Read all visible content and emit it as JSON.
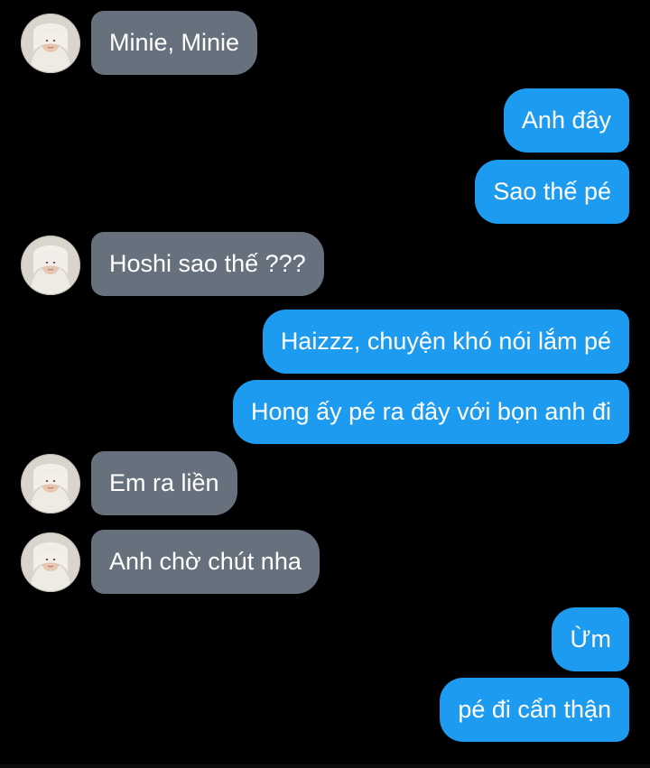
{
  "colors": {
    "background": "#000000",
    "incoming_bubble": "#67717d",
    "outgoing_bubble": "#1d9bf0",
    "bubble_text": "#ffffff"
  },
  "icons": {
    "avatar": "contact-avatar-icon"
  },
  "messages": [
    {
      "direction": "incoming",
      "text": "Minie, Minie",
      "has_avatar": true
    },
    {
      "direction": "outgoing",
      "text": "Anh đây"
    },
    {
      "direction": "outgoing",
      "text": "Sao thế pé"
    },
    {
      "direction": "incoming",
      "text": "Hoshi sao thế ???",
      "has_avatar": true
    },
    {
      "direction": "outgoing",
      "text": "Haizzz, chuyện khó nói lắm pé"
    },
    {
      "direction": "outgoing",
      "text": "Hong ấy pé ra đây với bọn anh đi"
    },
    {
      "direction": "incoming",
      "text": "Em ra liền",
      "has_avatar": true
    },
    {
      "direction": "incoming",
      "text": "Anh chờ chút nha",
      "has_avatar": true
    },
    {
      "direction": "outgoing",
      "text": "Ừm"
    },
    {
      "direction": "outgoing",
      "text": "pé đi cẩn thận"
    }
  ]
}
